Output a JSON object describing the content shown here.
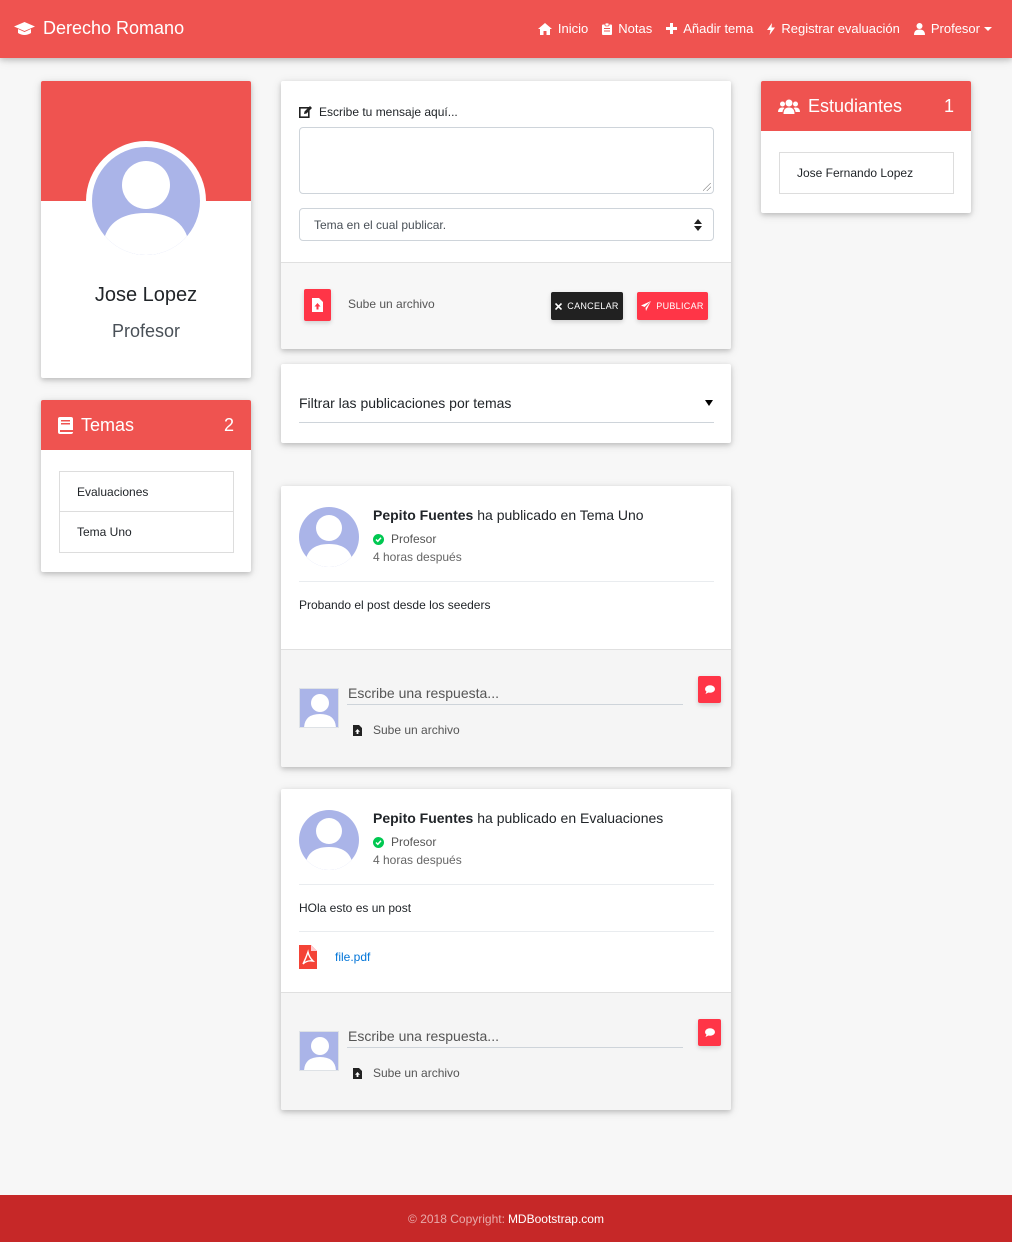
{
  "navbar": {
    "brand": "Derecho Romano",
    "links": {
      "inicio": "Inicio",
      "notas": "Notas",
      "anadir_tema": "Añadir tema",
      "registrar": "Registrar evaluación",
      "profesor": "Profesor"
    },
    "icons": [
      "graduation-cap-icon",
      "home-icon",
      "clipboard-icon",
      "plus-icon",
      "bolt-icon",
      "user-icon"
    ]
  },
  "profile": {
    "name": "Jose Lopez",
    "role": "Profesor"
  },
  "temas": {
    "title": "Temas",
    "count": "2",
    "items": [
      "Evaluaciones",
      "Tema Uno"
    ]
  },
  "estudiantes": {
    "title": "Estudiantes",
    "count": "1",
    "items": [
      "Jose Fernando Lopez"
    ]
  },
  "compose": {
    "label": "Escribe tu mensaje aquí...",
    "select_placeholder": "Tema en el cual publicar.",
    "file_label": "Sube un archivo",
    "cancel": "CANCELAR",
    "publish": "PUBLICAR"
  },
  "filter": {
    "label": "Filtrar las publicaciones por temas"
  },
  "posts": [
    {
      "author": "Pepito Fuentes",
      "verb": " ha publicado en ",
      "topic": "Tema Uno",
      "role": "Profesor",
      "time": "4 horas después",
      "body": "Probando el post desde los seeders",
      "reply_placeholder": "Escribe una respuesta...",
      "reply_file": "Sube un archivo"
    },
    {
      "author": "Pepito Fuentes",
      "verb": " ha publicado en ",
      "topic": "Evaluaciones",
      "role": "Profesor",
      "time": "4 horas después",
      "body": "HOla esto es un post",
      "attachment": "file.pdf",
      "reply_placeholder": "Escribe una respuesta...",
      "reply_file": "Sube un archivo"
    }
  ],
  "footer": {
    "text": "© 2018 Copyright:",
    "link": "MDBootstrap.com"
  },
  "colors": {
    "primary": "#ef5350",
    "danger": "#ff3547",
    "footer": "#c62828",
    "avatar": "#aab4e8",
    "success": "#00c851"
  }
}
